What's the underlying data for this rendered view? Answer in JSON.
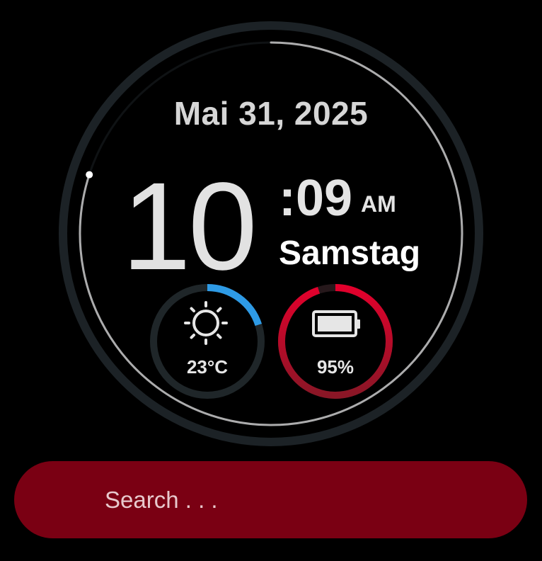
{
  "clock": {
    "date": "Mai 31, 2025",
    "hour": "10",
    "minutes": ":09",
    "ampm": "AM",
    "weekday": "Samstag",
    "seconds_progress": 0.8
  },
  "weather": {
    "temperature": "23°C",
    "icon": "sun-icon",
    "level": 0.2,
    "accent_color": "#2e9be6"
  },
  "battery": {
    "percent_label": "95%",
    "level": 0.95,
    "icon": "battery-icon",
    "accent_color": "#e3002c"
  },
  "search": {
    "placeholder": "Search . . ."
  },
  "colors": {
    "background": "#000000",
    "search_bar": "#7a0013"
  }
}
